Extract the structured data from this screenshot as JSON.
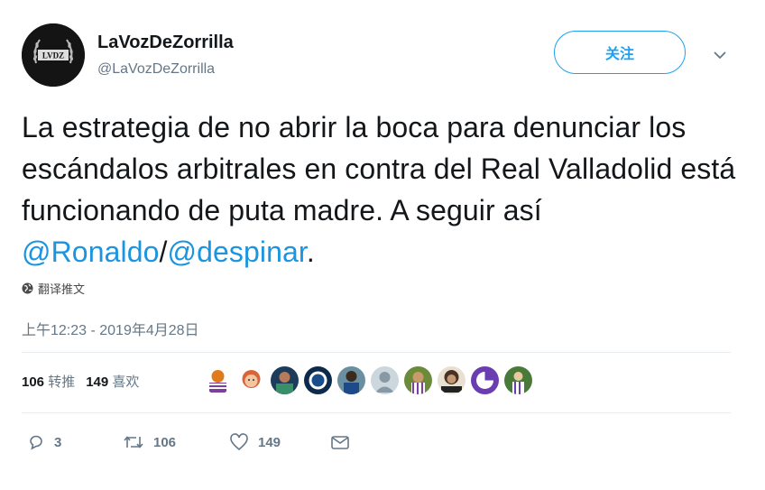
{
  "user": {
    "display_name": "LaVozDeZorrilla",
    "handle": "@LaVozDeZorrilla",
    "avatar_text": "LVDZ"
  },
  "follow_label": "关注",
  "tweet": {
    "text_main": "La estrategia de no abrir la boca para denunciar los escándalos arbitrales en contra del Real Valladolid está funcionando de puta madre. A seguir así ",
    "mention_1": "@Ronaldo",
    "separator": "/",
    "mention_2": "@despinar",
    "trailing": "."
  },
  "translate_label": "翻译推文",
  "timestamp": "上午12:23 - 2019年4月28日",
  "stats": {
    "retweets": "106",
    "retweets_label": "转推",
    "likes": "149",
    "likes_label": "喜欢"
  },
  "liker_avatars": [
    "avatar-1",
    "avatar-2",
    "avatar-3",
    "avatar-4",
    "avatar-5",
    "avatar-6",
    "avatar-7",
    "avatar-8",
    "avatar-9"
  ],
  "actions": {
    "replies": "3",
    "retweets": "106",
    "likes": "149"
  },
  "colors": {
    "accent": "#1da1f2",
    "mention": "#1b95e0",
    "muted": "#657786"
  }
}
